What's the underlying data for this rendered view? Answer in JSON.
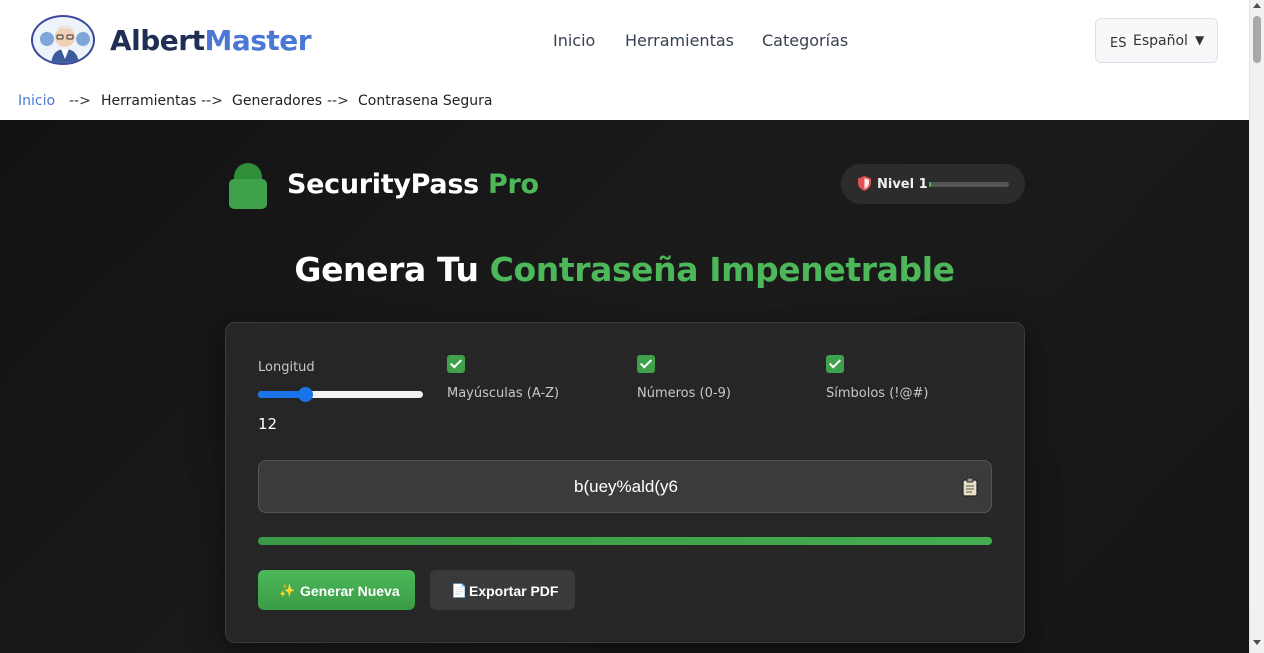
{
  "header": {
    "brand_part1": "Albert",
    "brand_part2": "Master",
    "nav": [
      "Inicio",
      "Herramientas",
      "Categorías"
    ],
    "lang_code": "ES",
    "lang_name": "Español",
    "lang_arrow": "▼"
  },
  "breadcrumb": {
    "items": [
      "Inicio",
      "Herramientas",
      "Generadores",
      "Contrasena Segura"
    ],
    "separator": "-->"
  },
  "app": {
    "title": "SecurityPass",
    "title_accent": "Pro",
    "level_label": "Nivel 1",
    "level_progress": 0.03,
    "headline": "Genera Tu",
    "headline_accent": "Contraseña Impenetrable"
  },
  "options": {
    "length_label": "Longitud",
    "length_value": "12",
    "length_min": 4,
    "length_max": 64,
    "uppercase_label": "Mayúsculas (A-Z)",
    "numbers_label": "Números (0-9)",
    "symbols_label": "Símbolos (!@#)",
    "uppercase_checked": true,
    "numbers_checked": true,
    "symbols_checked": true
  },
  "password": {
    "value": "b(uey%ald(y6",
    "strength": 1.0
  },
  "buttons": {
    "generate": "Generar Nueva",
    "export": "Exportar PDF"
  },
  "colors": {
    "accent_green": "#4cb859",
    "link_blue": "#4a78d4",
    "brand_dark": "#1f2e52",
    "slider_blue": "#1a73e8"
  },
  "icons": {
    "logo": "albert-avatar-logo",
    "lock": "lock-icon",
    "shield": "shield-icon",
    "clipboard": "clipboard-icon",
    "sparkle": "sparkle-icon",
    "document": "document-icon"
  }
}
